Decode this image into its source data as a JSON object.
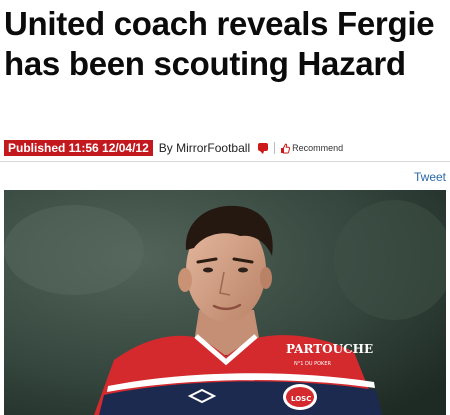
{
  "article": {
    "headline": "United coach reveals Fergie has been scouting Hazard",
    "published_label": "Published 11:56 12/04/12",
    "byline": "By MirrorFootball",
    "recommend_label": "Recommend"
  },
  "social": {
    "tweet_label": "Tweet"
  },
  "photo": {
    "sponsor_text": "PARTOUCHE",
    "sponsor_subtext": "N°1 DU POKER",
    "club_badge_text": "LOSC"
  },
  "colors": {
    "published_bg": "#c4181f",
    "link": "#2a6aa8",
    "shirt_red": "#d42a2d",
    "shirt_navy": "#1c2a4f"
  },
  "icons": [
    "comment-icon",
    "thumbs-up-icon"
  ]
}
